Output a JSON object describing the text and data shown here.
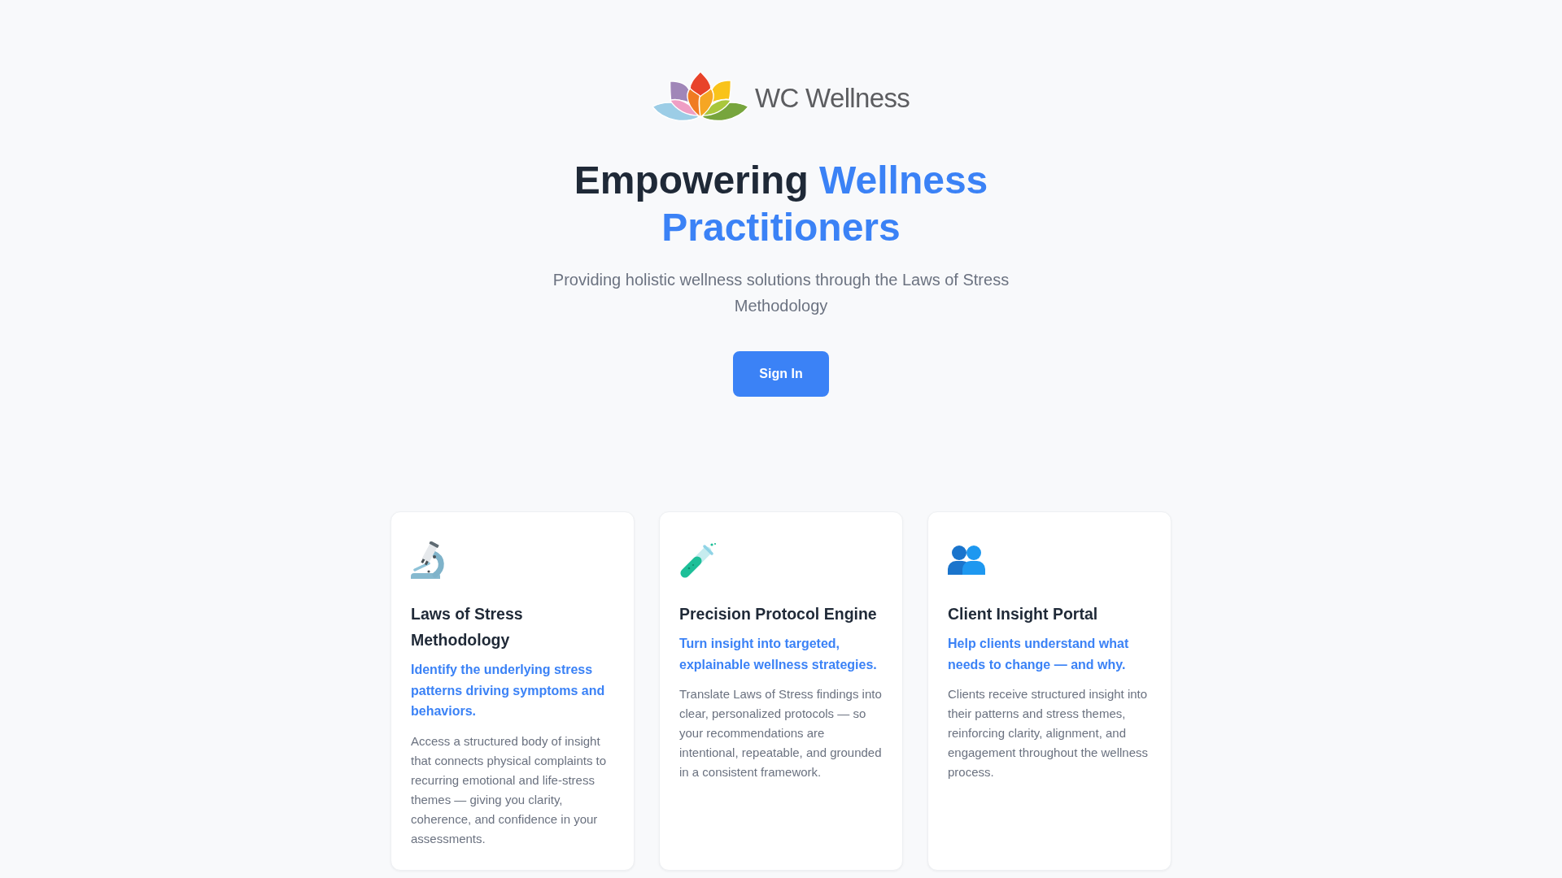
{
  "logo": {
    "brand": "WC Wellness"
  },
  "hero": {
    "title_lead": "Empowering",
    "title_highlight": "Wellness Practitioners",
    "subtitle": "Providing holistic wellness solutions through the Laws of Stress Methodology",
    "cta": {
      "label": "Sign In"
    }
  },
  "features": [
    {
      "title": "Laws of Stress Methodology",
      "tagline": "Identify the underlying stress patterns driving symptoms and behaviors.",
      "description": "Access a structured body of insight that connects physical complaints to recurring emotional and life-stress themes — giving you clarity, coherence, and confidence in your assessments."
    },
    {
      "title": "Precision Protocol Engine",
      "tagline": "Turn insight into targeted, explainable wellness strategies.",
      "description": "Translate Laws of Stress findings into clear, personalized protocols — so your recommendations are intentional, repeatable, and grounded in a consistent framework."
    },
    {
      "title": "Client Insight Portal",
      "tagline": "Help clients understand what needs to change — and why.",
      "description": "Clients receive structured insight into their patterns and stress themes, reinforcing clarity, alignment, and engagement throughout the wellness process."
    }
  ]
}
